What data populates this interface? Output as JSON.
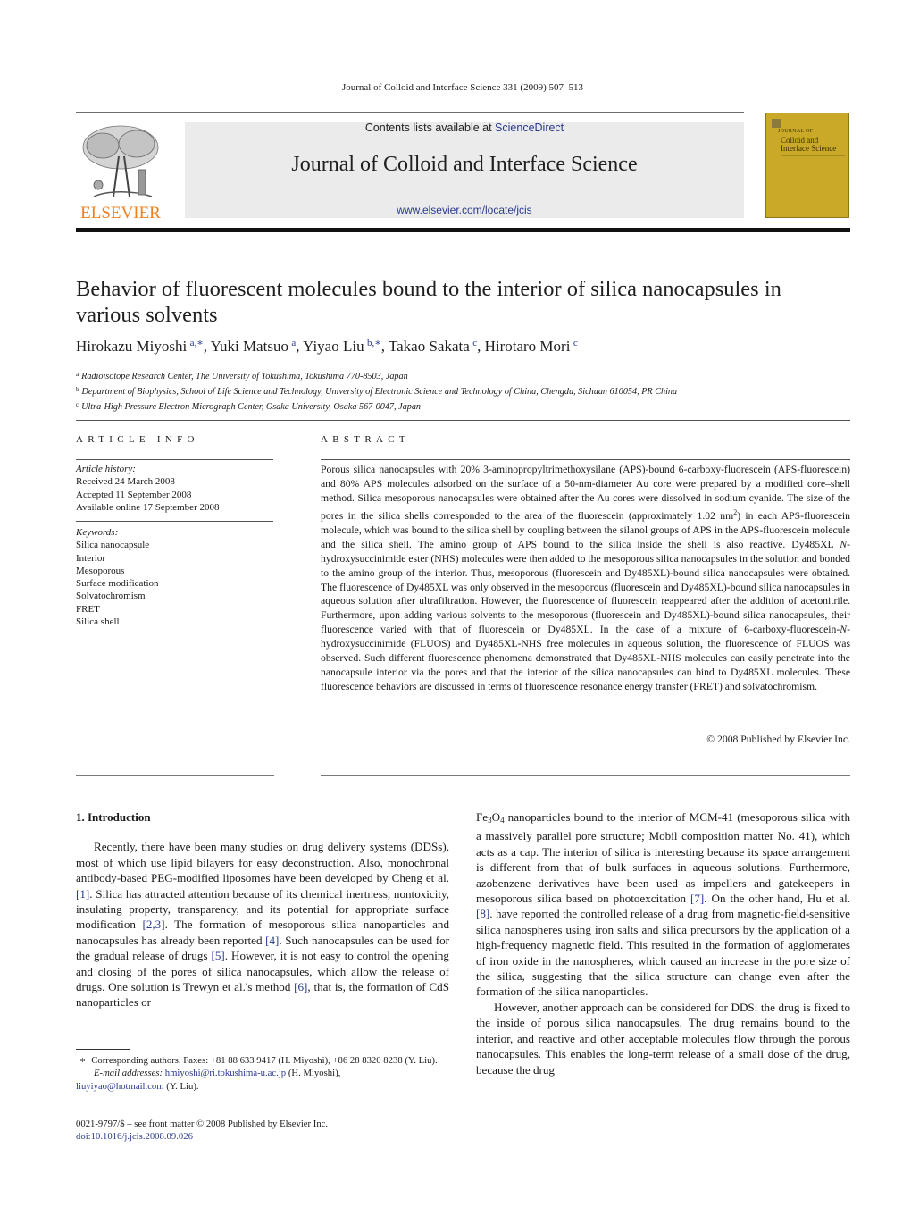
{
  "running_head": "Journal of Colloid and Interface Science 331 (2009) 507–513",
  "header": {
    "publisher_wordmark": "ELSEVIER",
    "contents_prefix": "Contents lists available at ",
    "contents_link": "ScienceDirect",
    "journal_name": "Journal of Colloid and Interface Science",
    "journal_url": "www.elsevier.com/locate/jcis",
    "cover": {
      "small_label": "JOURNAL OF",
      "title_line1": "Colloid and",
      "title_line2": "Interface Science",
      "color": "#c9a927"
    },
    "publisher_color": "#f07f1f",
    "link_color": "#2a3a8f"
  },
  "article": {
    "title": "Behavior of fluorescent molecules bound to the interior of silica nanocapsules in various solvents",
    "authors": [
      {
        "name": "Hirokazu Miyoshi",
        "affil": "a,∗",
        "sep": ", "
      },
      {
        "name": "Yuki Matsuo",
        "affil": "a",
        "sep": ", "
      },
      {
        "name": "Yiyao Liu",
        "affil": "b,∗",
        "sep": ", "
      },
      {
        "name": "Takao Sakata",
        "affil": "c",
        "sep": ", "
      },
      {
        "name": "Hirotaro Mori",
        "affil": "c",
        "sep": ""
      }
    ],
    "affiliations": [
      {
        "mark": "a",
        "text": "Radioisotope Research Center, The University of Tokushima, Tokushima 770-8503, Japan"
      },
      {
        "mark": "b",
        "text": "Department of Biophysics, School of Life Science and Technology, University of Electronic Science and Technology of China, Chengdu, Sichuan 610054, PR China"
      },
      {
        "mark": "c",
        "text": "Ultra-High Pressure Electron Micrograph Center, Osaka University, Osaka 567-0047, Japan"
      }
    ]
  },
  "article_info": {
    "label": "ARTICLE INFO",
    "history_label": "Article history:",
    "received": "Received 24 March 2008",
    "accepted": "Accepted 11 September 2008",
    "online": "Available online 17 September 2008",
    "keywords_label": "Keywords:",
    "keywords": [
      "Silica nanocapsule",
      "Interior",
      "Mesoporous",
      "Surface modification",
      "Solvatochromism",
      "FRET",
      "Silica shell"
    ]
  },
  "abstract": {
    "label": "ABSTRACT",
    "text_part1": "Porous silica nanocapsules with 20% 3-aminopropyltrimethoxysilane (APS)-bound 6-carboxy-fluorescein (APS-fluorescein) and 80% APS molecules adsorbed on the surface of a 50-nm-diameter Au core were prepared by a modified core–shell method. Silica mesoporous nanocapsules were obtained after the Au cores were dissolved in sodium cyanide. The size of the pores in the silica shells corresponded to the area of the fluorescein (approximately 1.02 nm",
    "superscript": "2",
    "text_part2": ") in each APS-fluorescein molecule, which was bound to the silica shell by coupling between the silanol groups of APS in the APS-fluorescein molecule and the silica shell. The amino group of APS bound to the silica inside the shell is also reactive. Dy485XL ",
    "italic_n1": "N",
    "text_part3": "-hydroxysuccinimide ester (NHS) molecules were then added to the mesoporous silica nanocapsules in the solution and bonded to the amino group of the interior. Thus, mesoporous (fluorescein and Dy485XL)-bound silica nanocapsules were obtained. The fluorescence of Dy485XL was only observed in the mesoporous (fluorescein and Dy485XL)-bound silica nanocapsules in aqueous solution after ultrafiltration. However, the fluorescence of fluorescein reappeared after the addition of acetonitrile. Furthermore, upon adding various solvents to the mesoporous (fluorescein and Dy485XL)-bound silica nanocapsules, their fluorescence varied with that of fluorescein or Dy485XL. In the case of a mixture of 6-carboxy-fluorescein-",
    "italic_n2": "N",
    "text_part4": "-hydroxysuccinimide (FLUOS) and Dy485XL-NHS free molecules in aqueous solution, the fluorescence of FLUOS was observed. Such different fluorescence phenomena demonstrated that Dy485XL-NHS molecules can easily penetrate into the nanocapsule interior via the pores and that the interior of the silica nanocapsules can bind to Dy485XL molecules. These fluorescence behaviors are discussed in terms of fluorescence resonance energy transfer (FRET) and solvatochromism.",
    "copyright": "© 2008 Published by Elsevier Inc."
  },
  "body": {
    "section_heading": "1. Introduction",
    "left_para": [
      {
        "t": "Recently, there have been many studies on drug delivery systems (DDSs), most of which use lipid bilayers for easy deconstruction. Also, monochronal antibody-based PEG-modified liposomes have been developed by Cheng et al. "
      },
      {
        "ref": "[1]"
      },
      {
        "t": ". Silica has attracted attention because of its chemical inertness, nontoxicity, insulating property, transparency, and its potential for appropriate surface modification "
      },
      {
        "ref": "[2,3]"
      },
      {
        "t": ". The formation of mesoporous silica nanoparticles and nanocapsules has already been reported "
      },
      {
        "ref": "[4]"
      },
      {
        "t": ". Such nanocapsules can be used for the gradual release of drugs "
      },
      {
        "ref": "[5]"
      },
      {
        "t": ". However, it is not easy to control the opening and closing of the pores of silica nanocapsules, which allow the release of drugs. One solution is Trewyn et al.'s method "
      },
      {
        "ref": "[6]"
      },
      {
        "t": ", that is, the formation of CdS nanoparticles or"
      }
    ],
    "right_para1": [
      {
        "t": "Fe"
      },
      {
        "sub": "3"
      },
      {
        "t": "O"
      },
      {
        "sub": "4"
      },
      {
        "t": " nanoparticles bound to the interior of MCM-41 (mesoporous silica with a massively parallel pore structure; Mobil composition matter No. 41), which acts as a cap. The interior of silica is interesting because its space arrangement is different from that of bulk surfaces in aqueous solutions. Furthermore, azobenzene derivatives have been used as impellers and gatekeepers in mesoporous silica based on photoexcitation "
      },
      {
        "ref": "[7]"
      },
      {
        "t": ". On the other hand, Hu et al. "
      },
      {
        "ref": "[8]"
      },
      {
        "t": ". have reported the controlled release of a drug from magnetic-field-sensitive silica nanospheres using iron salts and silica precursors by the application of a high-frequency magnetic field. This resulted in the formation of agglomerates of iron oxide in the nanospheres, which caused an increase in the pore size of the silica, suggesting that the silica structure can change even after the formation of the silica nanoparticles."
      }
    ],
    "right_para2": "However, another approach can be considered for DDS: the drug is fixed to the inside of porous silica nanocapsules. The drug remains bound to the interior, and reactive and other acceptable molecules flow through the porous nanocapsules. This enables the long-term release of a small dose of the drug, because the drug"
  },
  "footnotes": {
    "star": "∗",
    "corresponding": "Corresponding authors. Faxes: +81 88 633 9417 (H. Miyoshi), +86 28 8320 8238 (Y. Liu).",
    "email_label": "E-mail addresses:",
    "email1": "hmiyoshi@ri.tokushima-u.ac.jp",
    "email1_owner": " (H. Miyoshi),",
    "email2": "liuyiyao@hotmail.com",
    "email2_owner": " (Y. Liu).",
    "front_matter": "0021-9797/$ – see front matter  © 2008 Published by Elsevier Inc.",
    "doi": "doi:10.1016/j.jcis.2008.09.026"
  }
}
